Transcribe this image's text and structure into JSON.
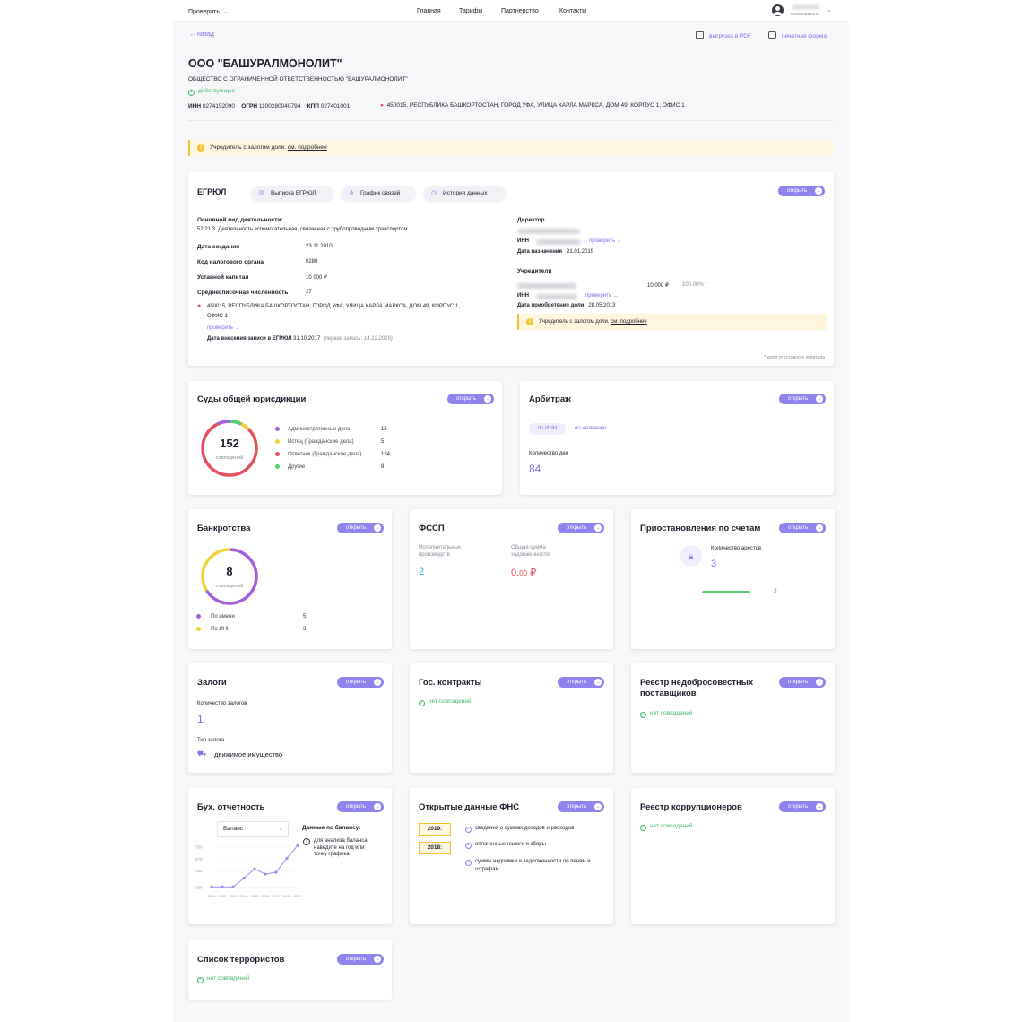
{
  "header": {
    "check_menu": "Проверить",
    "nav": [
      "Главная",
      "Тарифы",
      "Партнерство",
      "Контакты"
    ],
    "user_label": "пользователь"
  },
  "toolbar": {
    "back": "назад",
    "pdf": "выгрузка в PDF",
    "print": "печатная форма"
  },
  "company": {
    "name": "ООО \"БАШУРАЛМОНОЛИТ\"",
    "full_name": "ОБЩЕСТВО С ОГРАНИЧЕННОЙ ОТВЕТСТВЕННОСТЬЮ \"БАШУРАЛМОНОЛИТ\"",
    "status": "действующее",
    "inn_label": "ИНН",
    "inn": "0274152090",
    "ogrn_label": "ОГРН",
    "ogrn": "1100280040794",
    "kpp_label": "КПП",
    "kpp": "027401001",
    "address": "450015, РЕСПУБЛИКА БАШКОРТОСТАН, ГОРОД УФА, УЛИЦА КАРЛА МАРКСА, ДОМ 49, КОРПУС 1, ОФИС 1"
  },
  "banner": {
    "text": "Учредитель с залогом доли.",
    "link": "см. подробнее"
  },
  "egrul": {
    "title": "ЕГРЮЛ",
    "tabs": [
      "Выписка ЕГРЮЛ",
      "График связей",
      "История данных"
    ],
    "open": "открыть",
    "activity_label": "Основной вид деятельности:",
    "activity_code": "52.21.3",
    "activity_text": "Деятельность вспомогательная, связанная с трубопроводным транспортом",
    "rows": [
      {
        "label": "Дата создания",
        "value": "23.11.2010"
      },
      {
        "label": "Код налогового органа",
        "value": "0280"
      },
      {
        "label": "Уставной капитал",
        "value": "10 000 ₽"
      },
      {
        "label": "Среднесписочная численность",
        "value": "27"
      }
    ],
    "address_line1": "450015, РЕСПУБЛИКА БАШКОРТОСТАН, ГОРОД УФА, УЛИЦА КАРЛА МАРКСА, ДОМ 49, КОРПУС 1,",
    "address_line2": "ОФИС 1",
    "verify": "проверить",
    "record_label": "Дата внесения записи в ЕГРЮЛ",
    "record_date": "31.10.2017",
    "first_record": "(первая запись: 14.12.2016)",
    "director_label": "Директор",
    "inn_label": "ИНН",
    "appoint_label": "Дата назначения",
    "appoint_date": "21.01.2015",
    "founders_label": "Учредители",
    "founder_amount": "10 000 ₽",
    "founder_share": "100.00% *",
    "acquire_label": "Дата приобретения доли",
    "acquire_date": "28.05.2013",
    "note": "* доля от уставного капитала"
  },
  "courts": {
    "title": "Суды общей юрисдикции",
    "open": "открыть",
    "total": "152",
    "total_label": "совпадений",
    "legend": [
      {
        "label": "Административные дела",
        "value": "15",
        "color": "#a25fe0"
      },
      {
        "label": "Истец (Гражданские дела)",
        "value": "5",
        "color": "#f0d33a"
      },
      {
        "label": "Ответчик (Гражданские дела)",
        "value": "124",
        "color": "#e5505c"
      },
      {
        "label": "Другие",
        "value": "8",
        "color": "#4ed16e"
      }
    ]
  },
  "arbitrage": {
    "title": "Арбитраж",
    "open": "открыть",
    "tab_inn": "по ИНН",
    "tab_name": "по названию",
    "count_label": "Количество дел",
    "count": "84"
  },
  "bankruptcy": {
    "title": "Банкротства",
    "open": "открыть",
    "total": "8",
    "total_label": "совпадений",
    "legend": [
      {
        "label": "По имени",
        "value": "5",
        "color": "#a25fe0"
      },
      {
        "label": "По ИНН",
        "value": "3",
        "color": "#f0d33a"
      }
    ]
  },
  "fssp": {
    "title": "ФССП",
    "open": "открыть",
    "col1_label": "Исполнительных производств",
    "col1_value": "2",
    "col2_label": "Общая сумма задолженности",
    "col2_value_main": "0.",
    "col2_value_cents": "00",
    "col2_currency": "₽"
  },
  "suspensions": {
    "title": "Приостановления по счетам",
    "open": "открыть",
    "count_label": "Количество арестов",
    "count": "3",
    "bar_value": "3"
  },
  "pledges": {
    "title": "Залоги",
    "open": "открыть",
    "count_label": "Количество залогов",
    "count": "1",
    "type_label": "Тип залога",
    "type_value": "движимое имущество"
  },
  "contracts": {
    "title": "Гос. контракты",
    "open": "открыть",
    "status": "нет совпадений"
  },
  "dishonest": {
    "title_line1": "Реестр недобросовестных",
    "title_line2": "поставщиков",
    "open": "открыть",
    "status": "нет совпадений"
  },
  "accounting": {
    "title": "Бух. отчетность",
    "open": "открыть",
    "select_value": "Баланс",
    "info_title": "Данные по балансу:",
    "info_text": [
      "для анализа баланса",
      "наведите на год или",
      "точку графика"
    ]
  },
  "chart_data": {
    "type": "line",
    "x": [
      "2011",
      "2012",
      "2013",
      "2014",
      "2015",
      "2016",
      "2017",
      "2018",
      "2019"
    ],
    "values": [
      150,
      150,
      150,
      280,
      420,
      340,
      370,
      580,
      770
    ],
    "yticks": [
      "750",
      "570",
      "393",
      "150"
    ],
    "ylim": [
      100,
      800
    ],
    "color": "#9b8df0"
  },
  "fns": {
    "title": "Открытые данные ФНС",
    "open": "открыть",
    "years": [
      "2019:",
      "2018:"
    ],
    "items": [
      "сведения о суммах доходов и расходов",
      "оплаченные налоги и сборы",
      "суммы недоимки и задолженности по пеням и штрафам"
    ]
  },
  "corruption": {
    "title": "Реестр коррупционеров",
    "open": "открыть",
    "status": "нет совпадений"
  },
  "terrorists": {
    "title": "Список террористов",
    "open": "открыть",
    "status": "нет совпадений"
  }
}
